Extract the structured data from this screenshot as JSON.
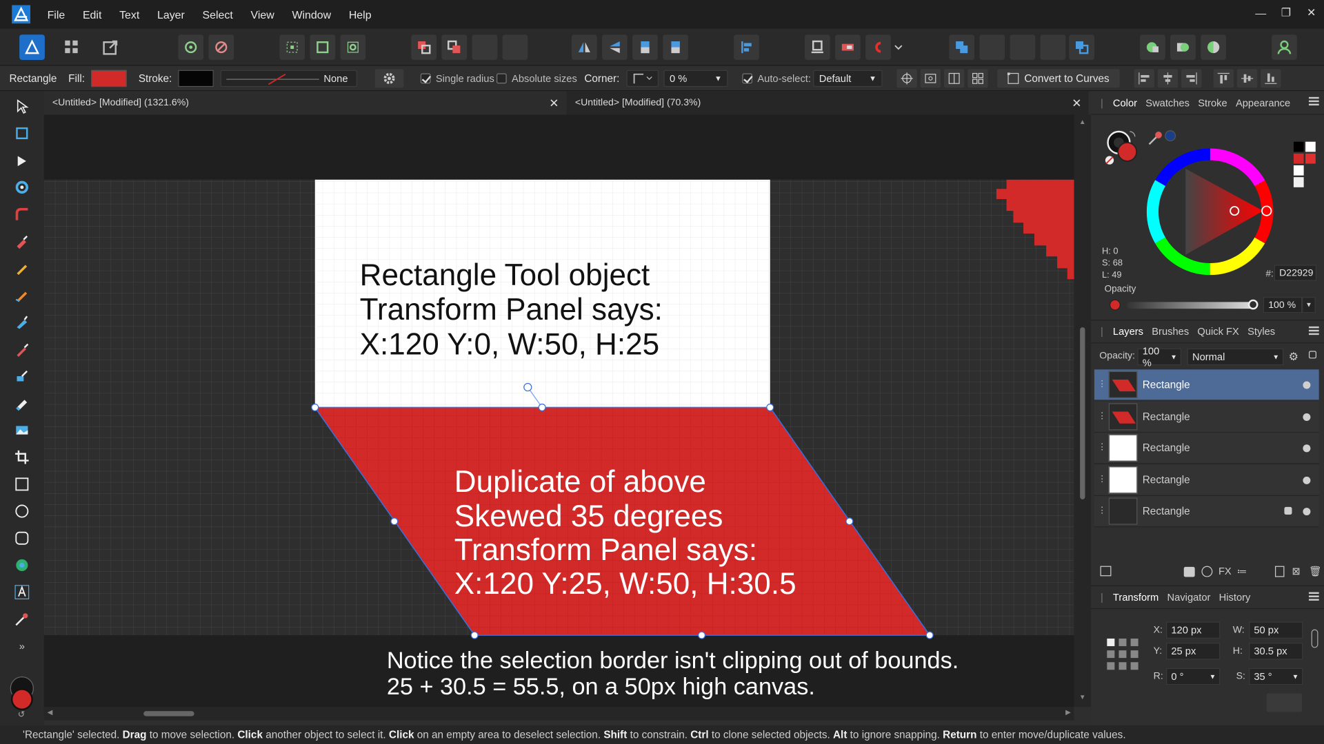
{
  "menu": [
    "File",
    "Edit",
    "Text",
    "Layer",
    "Select",
    "View",
    "Window",
    "Help"
  ],
  "context_bar": {
    "tool_name": "Rectangle",
    "fill_label": "Fill:",
    "stroke_label": "Stroke:",
    "stroke_style": "None",
    "single_radius": "Single radius",
    "absolute_sizes": "Absolute sizes",
    "corner_label": "Corner:",
    "corner_value": "0 %",
    "auto_select_label": "Auto-select:",
    "auto_select_value": "Default",
    "convert_label": "Convert to Curves"
  },
  "tabs": [
    {
      "label": "<Untitled> [Modified] (1321.6%)"
    },
    {
      "label": "<Untitled> [Modified] (70.3%)"
    }
  ],
  "canvas": {
    "note1_lines": [
      "Rectangle Tool object",
      "Transform Panel says:",
      "X:120 Y:0, W:50, H:25"
    ],
    "note2_lines": [
      "Duplicate of above",
      "Skewed 35 degrees",
      "Transform Panel says:",
      "X:120 Y:25, W:50, H:30.5"
    ],
    "note3_lines": [
      "Notice the selection border isn't clipping out of bounds.",
      "25 + 30.5 = 55.5, on a 50px high canvas."
    ]
  },
  "color_panel": {
    "tabs": [
      "Color",
      "Swatches",
      "Stroke",
      "Appearance"
    ],
    "h": "H: 0",
    "s": "S: 68",
    "l": "L: 49",
    "hex_label": "#:",
    "hex": "D22929",
    "opacity_label": "Opacity",
    "opacity_value": "100 %",
    "fill_color": "#d22929"
  },
  "layers_panel": {
    "tabs": [
      "Layers",
      "Brushes",
      "Quick FX",
      "Styles"
    ],
    "opacity_label": "Opacity:",
    "opacity_value": "100 %",
    "blend_mode": "Normal",
    "layers": [
      {
        "name": "Rectangle",
        "selected": true
      },
      {
        "name": "Rectangle",
        "selected": false
      },
      {
        "name": "Rectangle",
        "selected": false
      },
      {
        "name": "Rectangle",
        "selected": false
      },
      {
        "name": "Rectangle",
        "selected": false
      }
    ]
  },
  "transform_panel": {
    "tabs": [
      "Transform",
      "Navigator",
      "History"
    ],
    "x_label": "X:",
    "x": "120 px",
    "y_label": "Y:",
    "y": "25 px",
    "w_label": "W:",
    "w": "50 px",
    "h_label": "H:",
    "h": "30.5 px",
    "r_label": "R:",
    "r": "0 °",
    "s_label": "S:",
    "s": "35 °"
  },
  "status": {
    "segments": [
      {
        "t": "'Rectangle' selected. ",
        "b": false
      },
      {
        "t": "Drag",
        "b": true
      },
      {
        "t": " to move selection. ",
        "b": false
      },
      {
        "t": "Click",
        "b": true
      },
      {
        "t": " another object to select it. ",
        "b": false
      },
      {
        "t": "Click",
        "b": true
      },
      {
        "t": " on an empty area to deselect selection. ",
        "b": false
      },
      {
        "t": "Shift",
        "b": true
      },
      {
        "t": " to constrain. ",
        "b": false
      },
      {
        "t": "Ctrl",
        "b": true
      },
      {
        "t": " to clone selected objects. ",
        "b": false
      },
      {
        "t": "Alt",
        "b": true
      },
      {
        "t": " to ignore snapping. ",
        "b": false
      },
      {
        "t": "Return",
        "b": true
      },
      {
        "t": " to enter move/duplicate values.",
        "b": false
      }
    ]
  }
}
